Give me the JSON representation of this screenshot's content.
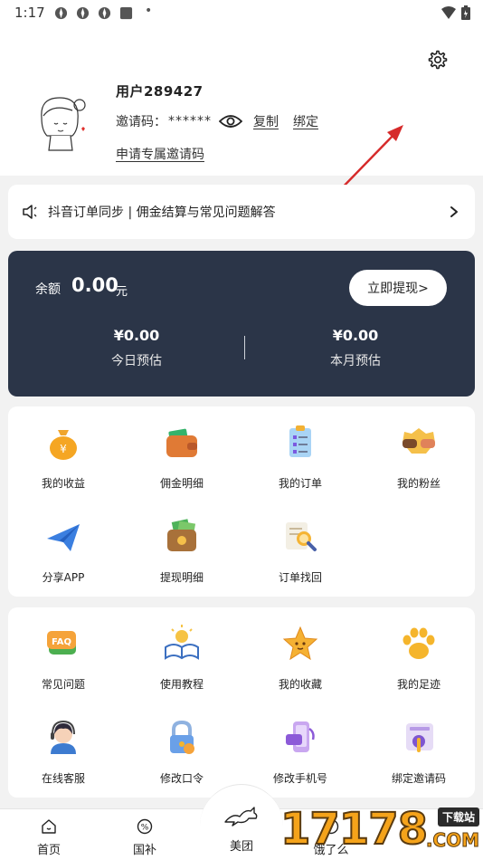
{
  "status_bar": {
    "time": "1:17",
    "dot": "•"
  },
  "profile": {
    "username": "用户289427",
    "invite_label": "邀请码：",
    "invite_masked": "******",
    "copy_label": "复制",
    "bind_label": "绑定",
    "apply_label": "申请专属邀请码"
  },
  "notice": {
    "text": "抖音订单同步 | 佣金结算与常见问题解答"
  },
  "balance": {
    "label": "余额",
    "amount": "0.00",
    "unit": "元",
    "withdraw_label": "立即提现>",
    "today_value": "¥0.00",
    "today_label": "今日预估",
    "month_value": "¥0.00",
    "month_label": "本月预估"
  },
  "grid1": [
    {
      "label": "我的收益",
      "icon": "money-bag-icon"
    },
    {
      "label": "佣金明细",
      "icon": "wallet-icon"
    },
    {
      "label": "我的订单",
      "icon": "clipboard-icon"
    },
    {
      "label": "我的粉丝",
      "icon": "handshake-icon"
    },
    {
      "label": "分享APP",
      "icon": "paper-plane-icon"
    },
    {
      "label": "提现明细",
      "icon": "cash-wallet-icon"
    },
    {
      "label": "订单找回",
      "icon": "search-document-icon"
    }
  ],
  "grid2": [
    {
      "label": "常见问题",
      "icon": "faq-icon"
    },
    {
      "label": "使用教程",
      "icon": "book-icon"
    },
    {
      "label": "我的收藏",
      "icon": "star-icon"
    },
    {
      "label": "我的足迹",
      "icon": "paw-icon"
    },
    {
      "label": "在线客服",
      "icon": "support-agent-icon"
    },
    {
      "label": "修改口令",
      "icon": "lock-icon"
    },
    {
      "label": "修改手机号",
      "icon": "phone-icon"
    },
    {
      "label": "绑定邀请码",
      "icon": "bind-code-icon"
    }
  ],
  "faq_badge": "FAQ",
  "bottom_nav": {
    "home": "首页",
    "subsidy": "国补",
    "meituan": "美团",
    "fourth": "饿了么",
    "subsidy_icon_glyph": "%"
  },
  "watermark": {
    "number": "17178",
    "tag": "下载站",
    "domain": ".COM"
  },
  "colors": {
    "card_dark": "#2b3548",
    "arrow_red": "#d62a2a",
    "accent_orange": "#f5a31a"
  }
}
